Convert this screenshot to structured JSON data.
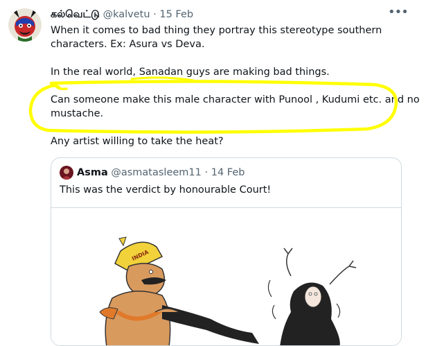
{
  "tweet": {
    "author_name": "கல்வெட்டு",
    "handle": "@kalvetu",
    "separator": "·",
    "date": "15 Feb",
    "more_label": "•••",
    "lines": [
      "When it comes to bad thing they portray this stereotype southern",
      "characters. Ex: Asura vs Deva.",
      "In the real world, Sanadan guys are making bad things.",
      "Can someone make this male character with Punool , Kudumi etc. and no",
      "mustache.",
      "Any artist willing to take the heat?"
    ]
  },
  "quoted_tweet": {
    "author_name": "Asma",
    "handle": "@asmatasleem11",
    "separator": "·",
    "date": "14 Feb",
    "text": "This was the verdict by honourable Court!",
    "image_crown_text": "INDIA"
  },
  "colors": {
    "highlight": "#ffff00",
    "muted": "#536471",
    "border": "#cfd9de"
  }
}
